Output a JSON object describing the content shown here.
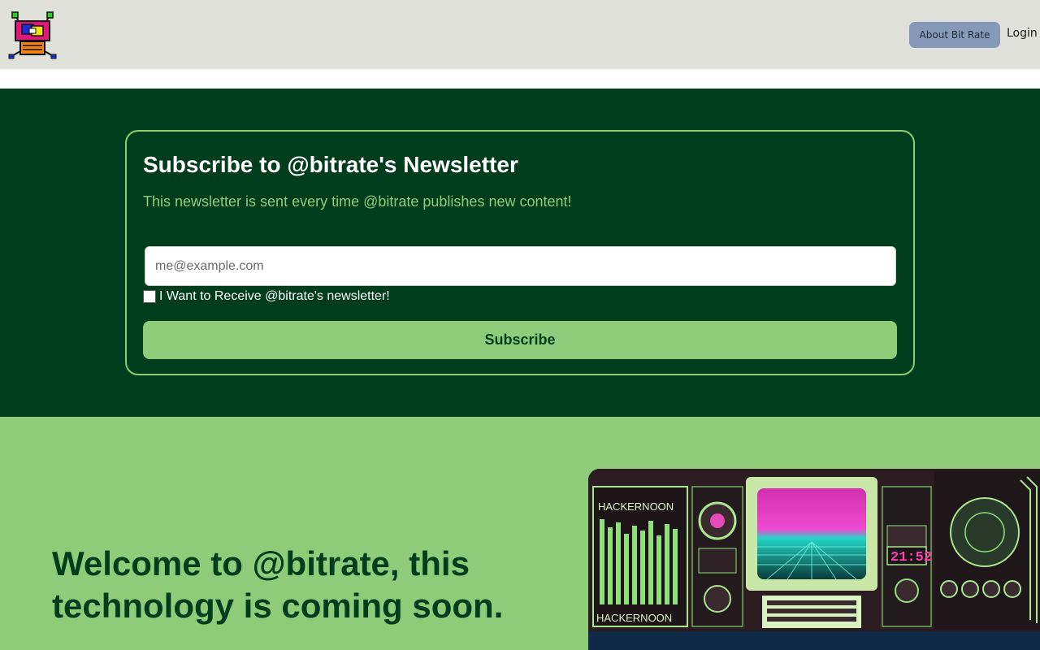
{
  "header": {
    "logo_icon": "robot-logo-icon",
    "about_label": "About Bit Rate",
    "login_label": "Login"
  },
  "newsletter": {
    "title": "Subscribe to @bitrate's Newsletter",
    "subtitle": "This newsletter is sent every time @bitrate publishes new content!",
    "email_placeholder": "me@example.com",
    "checkbox_label": "I Want to Receive @bitrate's newsletter!",
    "subscribe_label": "Subscribe"
  },
  "hero": {
    "title": "Welcome to @bitrate, this technology is coming soon.",
    "image_brand_top": "HACKERNOON",
    "image_brand_bottom": "HACKERNOON",
    "image_clock": "21:52"
  },
  "colors": {
    "header_bg": "#e1e1dc",
    "dark_green": "#003d1c",
    "light_green": "#8fcc7a",
    "about_button": "#8699b8"
  }
}
